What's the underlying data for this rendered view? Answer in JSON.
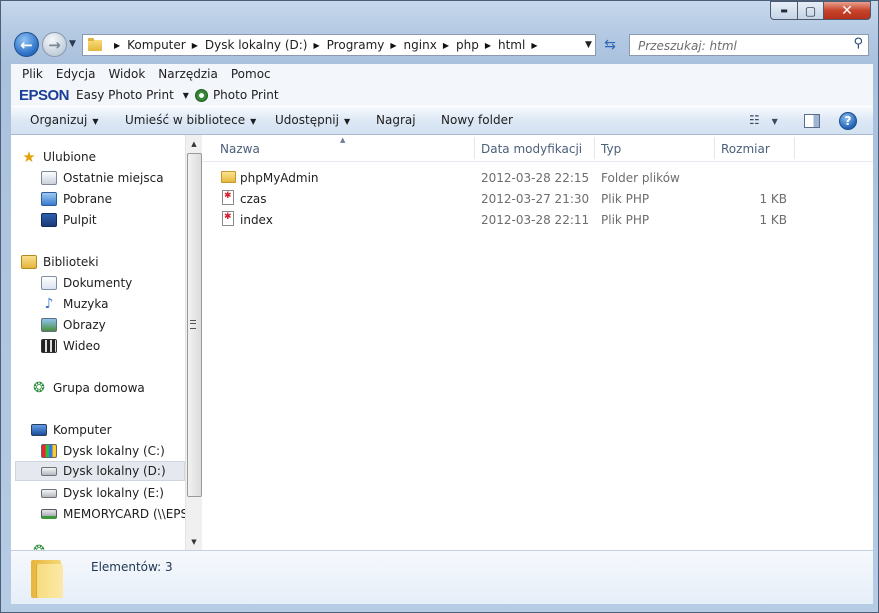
{
  "window": {
    "controls": {
      "minimize": "▬",
      "maximize": "▢",
      "close": "✕"
    }
  },
  "nav": {
    "back_glyph": "←",
    "forward_glyph": "→",
    "breadcrumb": [
      "Komputer",
      "Dysk lokalny (D:)",
      "Programy",
      "nginx",
      "php",
      "html"
    ],
    "search_placeholder": "Przeszukaj: html"
  },
  "menu": [
    "Plik",
    "Edycja",
    "Widok",
    "Narzędzia",
    "Pomoc"
  ],
  "epson": {
    "logo": "EPSON",
    "easy_photo_print": "Easy Photo Print",
    "photo_print": "Photo Print"
  },
  "commands": {
    "organize": "Organizuj",
    "add_to_library": "Umieść w bibliotece",
    "share": "Udostępnij",
    "burn": "Nagraj",
    "new_folder": "Nowy folder"
  },
  "sidebar": {
    "favorites": {
      "label": "Ulubione",
      "items": [
        "Ostatnie miejsca",
        "Pobrane",
        "Pulpit"
      ]
    },
    "libraries": {
      "label": "Biblioteki",
      "items": [
        "Dokumenty",
        "Muzyka",
        "Obrazy",
        "Wideo"
      ]
    },
    "homegroup": {
      "label": "Grupa domowa"
    },
    "computer": {
      "label": "Komputer",
      "items": [
        "Dysk lokalny (C:)",
        "Dysk lokalny (D:)",
        "Dysk lokalny (E:)",
        "MEMORYCARD (\\\\EPSON"
      ]
    },
    "selected": "Dysk lokalny (D:)"
  },
  "columns": {
    "name": "Nazwa",
    "modified": "Data modyfikacji",
    "type": "Typ",
    "size": "Rozmiar"
  },
  "files": [
    {
      "name": "phpMyAdmin",
      "modified": "2012-03-28 22:15",
      "type": "Folder plików",
      "size": "",
      "icon": "folder-icon"
    },
    {
      "name": "czas",
      "modified": "2012-03-27 21:30",
      "type": "Plik PHP",
      "size": "1 KB",
      "icon": "php-file-icon"
    },
    {
      "name": "index",
      "modified": "2012-03-28 22:11",
      "type": "Plik PHP",
      "size": "1 KB",
      "icon": "php-file-icon"
    }
  ],
  "status": {
    "text": "Elementów: 3"
  }
}
